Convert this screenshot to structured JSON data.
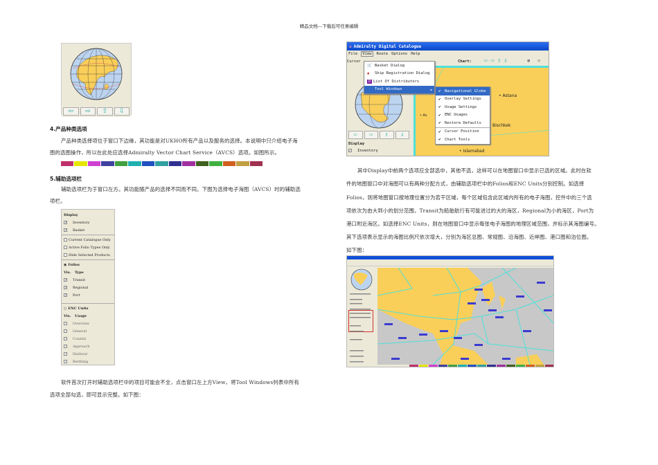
{
  "header": "精品文档---下载后可任意编辑",
  "left": {
    "globe_nav": [
      "arrow-left",
      "arrow-right",
      "arrow-up",
      "arrow-down"
    ],
    "section4": {
      "title": "4.产品种类选项",
      "lines": [
        "产品种类选择项位于窗口下边缘，其功能是对UKHO所有产品以及服务的选择。本说明中只介绍电子海",
        "图的选图操作，所以在此处应选择Admiralty Vector Chart Service（AVCS）选项。如图所示。"
      ]
    },
    "product_bar_colors": [
      "#c0306a",
      "#e6e600",
      "#d040d0",
      "#4040a0",
      "#40a040",
      "#20b0b0",
      "#2050c0",
      "#30a0a0",
      "#303090",
      "#a030a0",
      "#406020",
      "#40b040",
      "#d06020",
      "#c0a040",
      "#a03050"
    ],
    "section5": {
      "title": "5.辅助选项栏",
      "lines": [
        "辅助选项栏为于窗口左方。其功能随产品的选择不同而不同。下图为选择电子海图（AVCS）时的辅助选",
        "项栏。"
      ]
    },
    "panel": {
      "display_title": "Display",
      "display_items": [
        {
          "label": "Inventory",
          "checked": true
        },
        {
          "label": "Basket",
          "checked": true
        }
      ],
      "filters": [
        "Current Catalogue Only",
        "Active Folio Types Only",
        "Hide Selected Products"
      ],
      "folios": {
        "label": "Folios",
        "col1": "Vis.",
        "col2": "Type",
        "items": [
          "Transit",
          "Regional",
          "Port"
        ]
      },
      "enc": {
        "label": "ENC Units",
        "col1": "Vis.",
        "col2": "Usage",
        "items": [
          "Overview",
          "General",
          "Coastal",
          "Approach",
          "Harbour",
          "Berthing"
        ]
      }
    },
    "closing_lines": [
      "软件首次打开时辅助选项栏中的项目可能会不全，点击窗口左上方View，将Tool Windows列表中所有",
      "选项全部勾选，即可显示完整。如下图："
    ]
  },
  "right": {
    "app": {
      "title": "Admiralty Digital Catalogue",
      "menus": [
        "File",
        "View",
        "Route",
        "Options",
        "Help"
      ],
      "cursor_label": "Cursor",
      "chart_label": "Chart:",
      "view_menu": [
        "Basket Dialog",
        "Ship Registration Dialog",
        "List Of Distributors",
        "Tool Windows"
      ],
      "tool_windows": [
        "Navigational Globe",
        "Overlay Settings",
        "Usage Settings",
        "ENC Usages",
        "Restore Defaults",
        "Cursor Position",
        "Chart Tools"
      ],
      "cities": [
        "Astana",
        "Bischkek",
        "Islamabad",
        "As"
      ],
      "display_title": "Display",
      "display_item": "Inventory"
    },
    "lines": [
      "其中Display中前两个选项应全部选中，其他不选，这样可以在地图窗口中显示已选的区域。此时在软",
      "件的地图窗口中对海图可以有两种分配方式，由辅助选项栏中的Folios和ENC Units分别控制。如选择",
      "Folios，则将地图窗口按地理位置分为若干区域，每个区域包含此区域内所有的电子海图，控件中的三个选",
      "项依次为由大到小的划分范围，Transit为船舶航行有可能进过的大的海区，Regional为小的海区，Port为",
      "港口附近海区。如选择ENC Units，则在地图窗口中显示每张电子海图的地理区域范围，并标示其海图编号。",
      "其下选项表示显示的海图比例尺依次增大，分别为海区总图、常规图、沿海图、近岸图、港口图和泊位图。",
      "如下图："
    ]
  },
  "colors": {
    "land": "#f9cf5a",
    "sea": "#c8c8c8",
    "cyan": "#4ee0d8",
    "titlebar": "#0a52d8",
    "label": "#3a3ad0"
  }
}
